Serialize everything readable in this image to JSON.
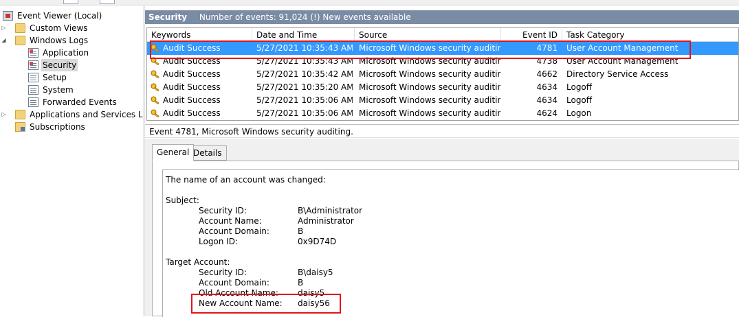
{
  "tree": {
    "root": "Event Viewer (Local)",
    "custom_views": "Custom Views",
    "windows_logs": "Windows Logs",
    "logs": [
      "Application",
      "Security",
      "Setup",
      "System",
      "Forwarded Events"
    ],
    "apps_services": "Applications and Services L",
    "subscriptions": "Subscriptions"
  },
  "header": {
    "log_name": "Security",
    "info": "Number of events: 91,024 (!) New events available"
  },
  "grid": {
    "columns": [
      "Keywords",
      "Date and Time",
      "Source",
      "Event ID",
      "Task Category"
    ],
    "rows": [
      [
        "Audit Success",
        "5/27/2021 10:35:43 AM",
        "Microsoft Windows security auditing.",
        "4781",
        "User Account Management"
      ],
      [
        "Audit Success",
        "5/27/2021 10:35:43 AM",
        "Microsoft Windows security auditing.",
        "4738",
        "User Account Management"
      ],
      [
        "Audit Success",
        "5/27/2021 10:35:42 AM",
        "Microsoft Windows security auditing.",
        "4662",
        "Directory Service Access"
      ],
      [
        "Audit Success",
        "5/27/2021 10:35:20 AM",
        "Microsoft Windows security auditing.",
        "4634",
        "Logoff"
      ],
      [
        "Audit Success",
        "5/27/2021 10:35:06 AM",
        "Microsoft Windows security auditing.",
        "4634",
        "Logoff"
      ],
      [
        "Audit Success",
        "5/27/2021 10:35:06 AM",
        "Microsoft Windows security auditing.",
        "4624",
        "Logon"
      ]
    ]
  },
  "detail": {
    "title": "Event 4781, Microsoft Windows security auditing.",
    "tabs": [
      "General",
      "Details"
    ],
    "intro": "The name of an account was changed:",
    "subject_heading": "Subject:",
    "subject": [
      [
        "Security ID:",
        "B\\Administrator"
      ],
      [
        "Account Name:",
        "Administrator"
      ],
      [
        "Account Domain:",
        "B"
      ],
      [
        "Logon ID:",
        "0x9D74D"
      ]
    ],
    "target_heading": "Target Account:",
    "target": [
      [
        "Security ID:",
        "B\\daisy5"
      ],
      [
        "Account Domain:",
        "B"
      ],
      [
        "Old Account Name:",
        "daisy5"
      ],
      [
        "New Account Name:",
        "daisy56"
      ]
    ]
  },
  "colors": {
    "header_bg": "#7a8ba6",
    "selection": "#3399ff",
    "highlight_box": "#e0141c"
  }
}
